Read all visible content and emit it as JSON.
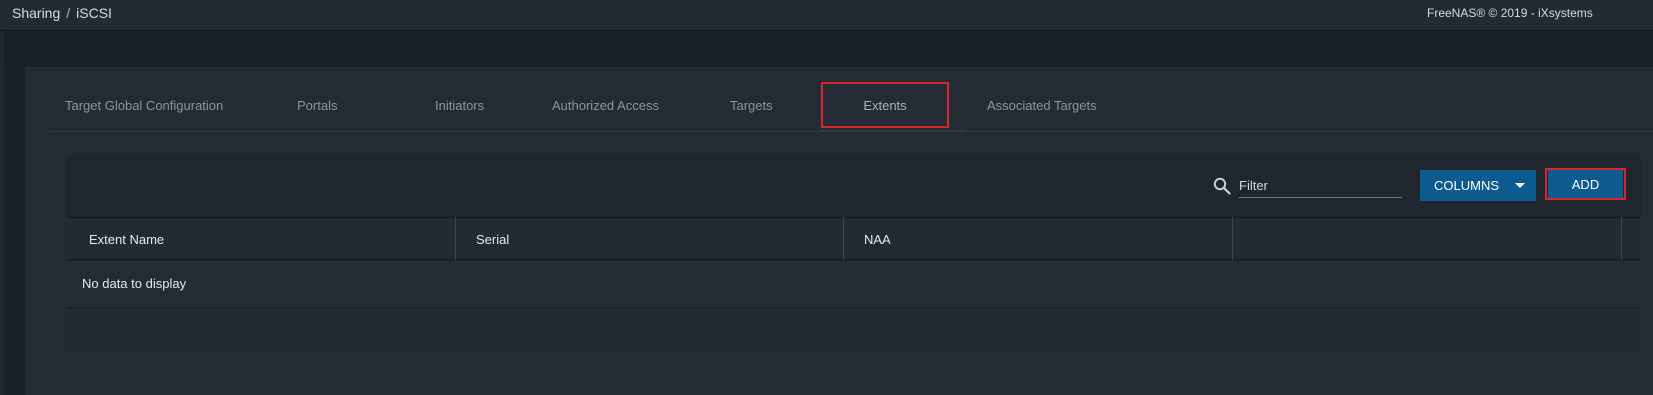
{
  "breadcrumb": {
    "section": "Sharing",
    "separator": "/",
    "page": "iSCSI"
  },
  "copyright": "FreeNAS® © 2019 - iXsystems",
  "tabs": [
    {
      "label": "Target Global Configuration"
    },
    {
      "label": "Portals"
    },
    {
      "label": "Initiators"
    },
    {
      "label": "Authorized Access"
    },
    {
      "label": "Targets"
    },
    {
      "label": "Extents",
      "active": true
    },
    {
      "label": "Associated Targets"
    }
  ],
  "toolbar": {
    "search_icon": "search-icon",
    "filter_placeholder": "Filter",
    "columns_label": "COLUMNS",
    "add_label": "ADD"
  },
  "table": {
    "columns": [
      "Extent Name",
      "Serial",
      "NAA",
      ""
    ],
    "empty_message": "No data to display"
  },
  "colors": {
    "background": "#1b2129",
    "card": "#232b34",
    "primary_button": "#0e5b91",
    "highlight": "#d9262b"
  }
}
